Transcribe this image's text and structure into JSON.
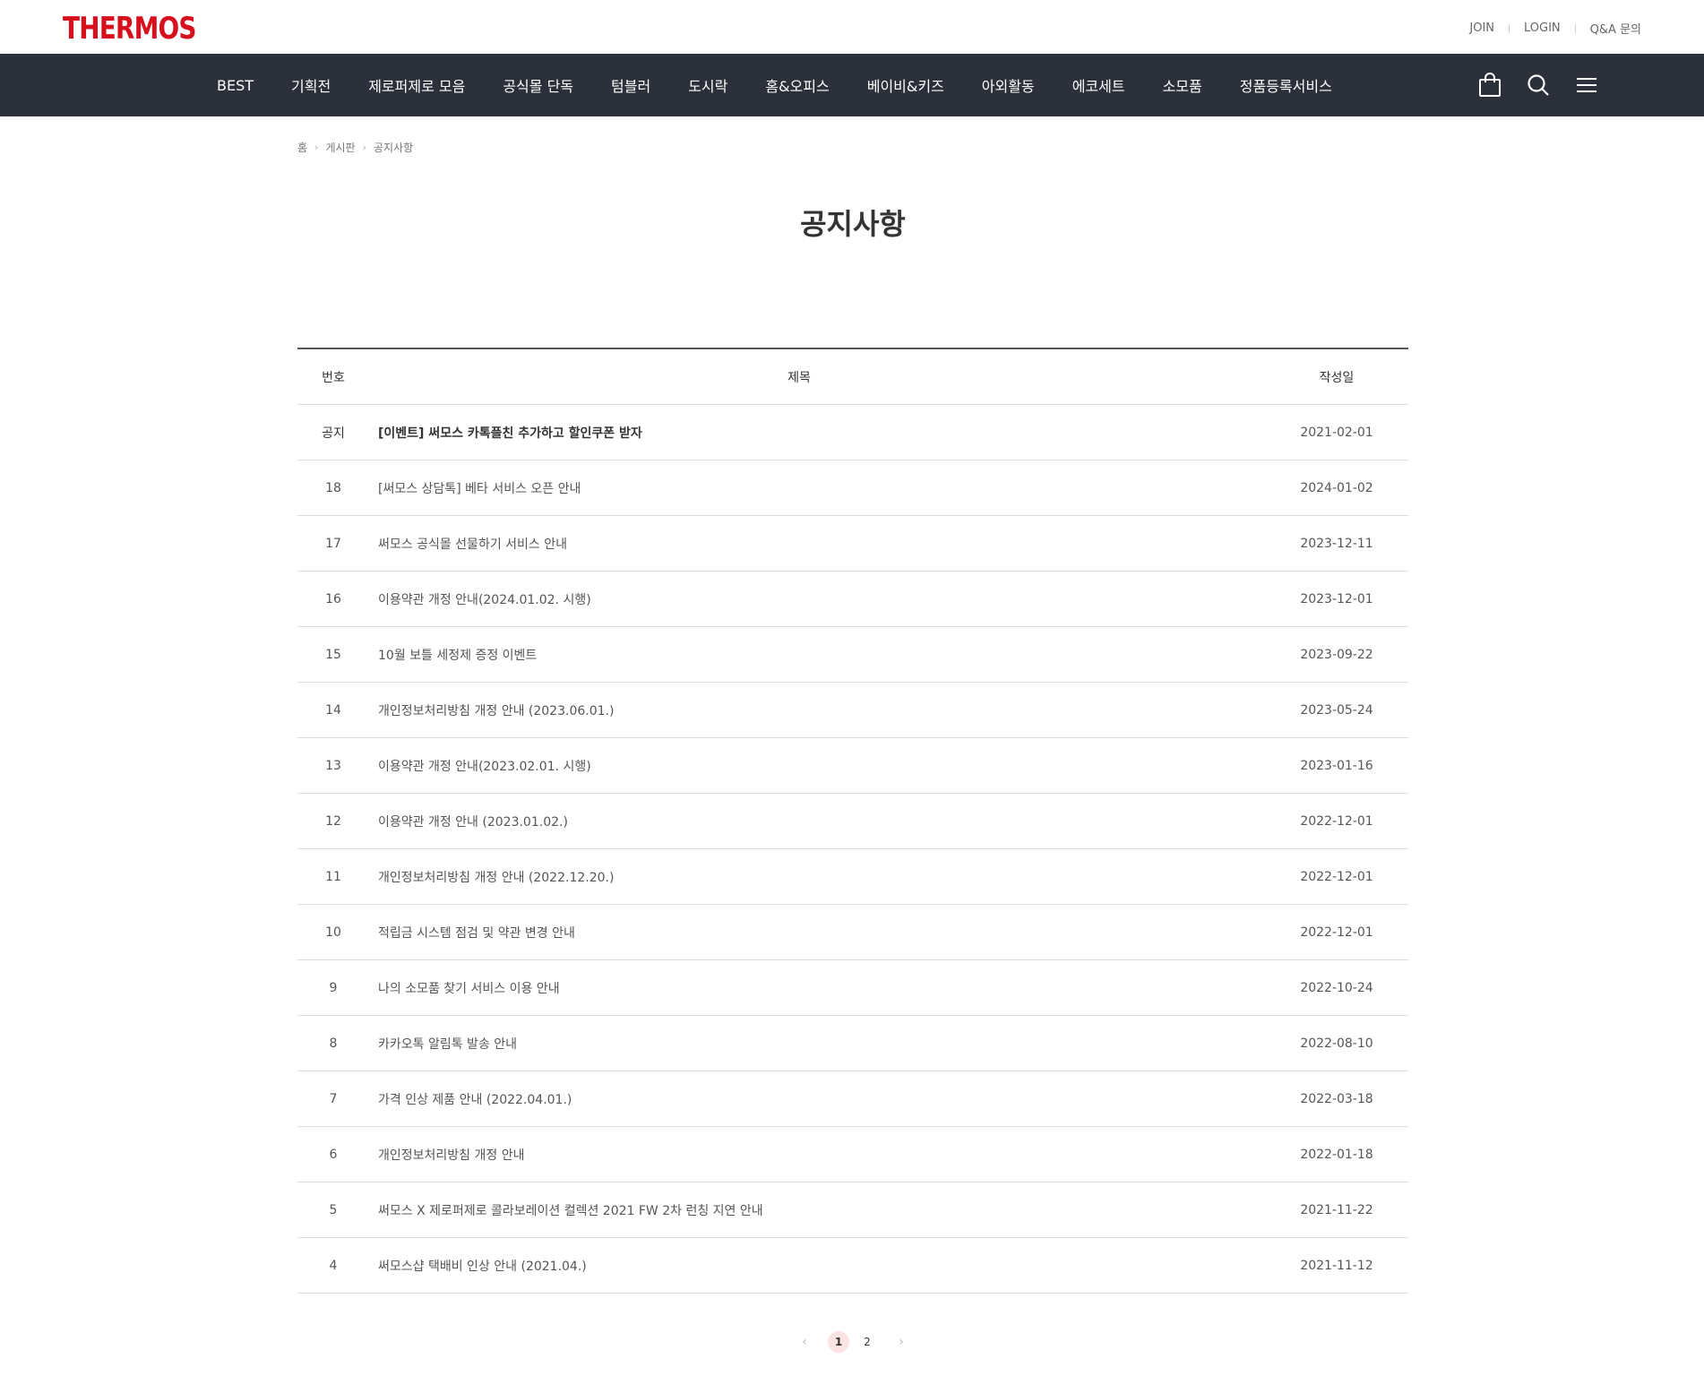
{
  "header": {
    "logo": "THERMOS",
    "util": [
      "JOIN",
      "LOGIN",
      "Q&A 문의"
    ]
  },
  "nav": {
    "items": [
      "BEST",
      "기획전",
      "제로퍼제로 모음",
      "공식몰 단독",
      "텀블러",
      "도시락",
      "홈&오피스",
      "베이비&키즈",
      "아외활동",
      "에코세트",
      "소모품",
      "정품등록서비스"
    ],
    "icons": [
      "shopping-bag-icon",
      "search-icon",
      "menu-icon"
    ]
  },
  "breadcrumb": [
    "홈",
    "게시판",
    "공지사항"
  ],
  "page_title": "공지사항",
  "table": {
    "headers": {
      "num": "번호",
      "title": "제목",
      "date": "작성일"
    },
    "rows": [
      {
        "num": "공지",
        "title": "[이벤트] 써모스 카톡플친 추가하고 할인쿠폰 받자",
        "date": "2021-02-01"
      },
      {
        "num": "18",
        "title": "[써모스 상담톡] 베타 서비스 오픈 안내",
        "date": "2024-01-02"
      },
      {
        "num": "17",
        "title": "써모스 공식몰 선물하기 서비스 안내",
        "date": "2023-12-11"
      },
      {
        "num": "16",
        "title": "이용약관 개정 안내(2024.01.02. 시행)",
        "date": "2023-12-01"
      },
      {
        "num": "15",
        "title": "10월 보틀 세정제 증정 이벤트",
        "date": "2023-09-22"
      },
      {
        "num": "14",
        "title": "개인정보처리방침 개정 안내 (2023.06.01.)",
        "date": "2023-05-24"
      },
      {
        "num": "13",
        "title": "이용약관 개정 안내(2023.02.01. 시행)",
        "date": "2023-01-16"
      },
      {
        "num": "12",
        "title": "이용약관 개정 안내 (2023.01.02.)",
        "date": "2022-12-01"
      },
      {
        "num": "11",
        "title": "개인정보처리방침 개정 안내 (2022.12.20.)",
        "date": "2022-12-01"
      },
      {
        "num": "10",
        "title": "적립금 시스템 점검 및 약관 변경 안내",
        "date": "2022-12-01"
      },
      {
        "num": "9",
        "title": "나의 소모품 찾기 서비스 이용 안내",
        "date": "2022-10-24"
      },
      {
        "num": "8",
        "title": "카카오톡 알림톡 발송 안내",
        "date": "2022-08-10"
      },
      {
        "num": "7",
        "title": "가격 인상 제품 안내 (2022.04.01.)",
        "date": "2022-03-18"
      },
      {
        "num": "6",
        "title": "개인정보처리방침 개정 안내",
        "date": "2022-01-18"
      },
      {
        "num": "5",
        "title": "써모스 X 제로퍼제로 콜라보레이션 컬렉션 2021 FW 2차 런칭 지연 안내",
        "date": "2021-11-22"
      },
      {
        "num": "4",
        "title": "써모스샵 택배비 인상 안내 (2021.04.)",
        "date": "2021-11-12"
      }
    ]
  },
  "pagination": {
    "prev": "‹",
    "next": "›",
    "pages": [
      "1",
      "2"
    ],
    "current": "1"
  },
  "colors": {
    "brand": "#d7101d",
    "nav_bg": "#2c303a",
    "active_page_bg": "#fbe2e3"
  }
}
